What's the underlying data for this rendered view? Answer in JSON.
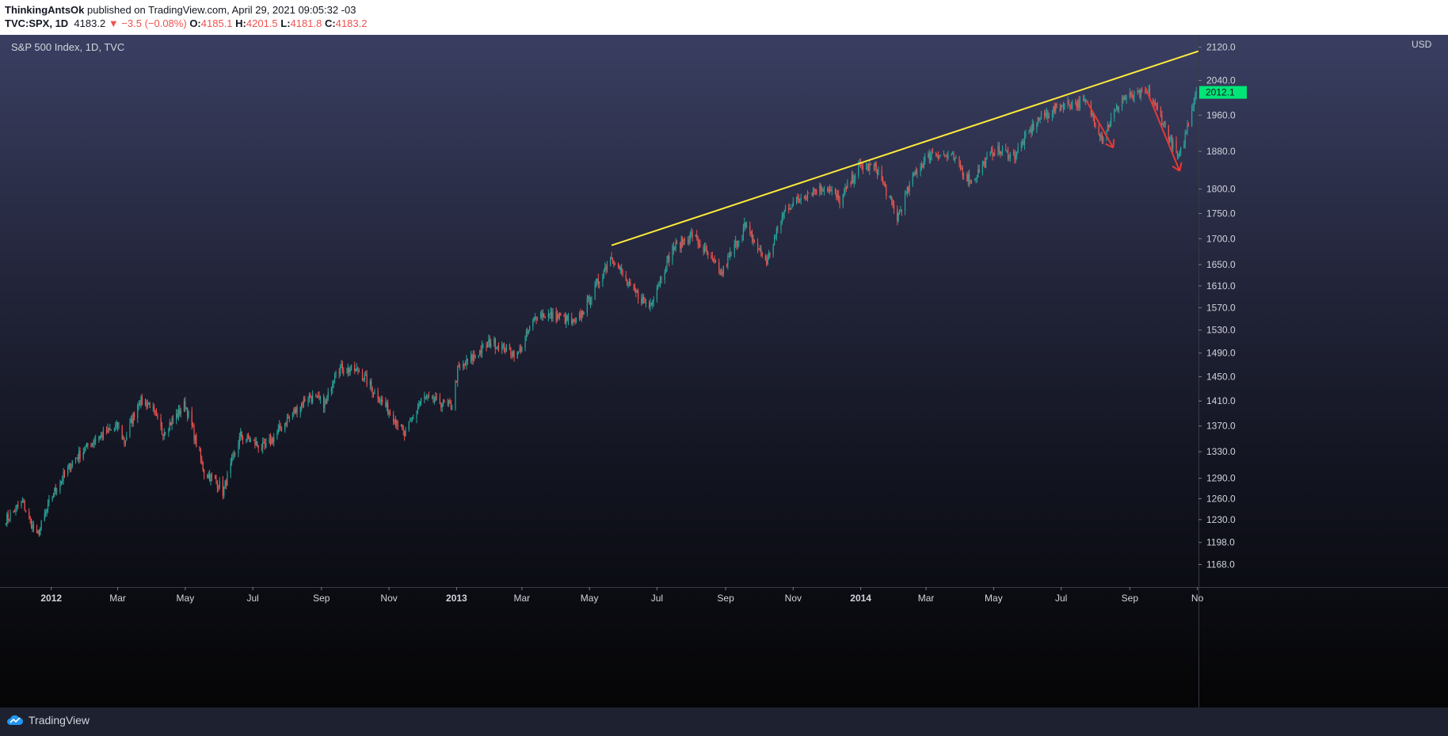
{
  "header": {
    "author": "ThinkingAntsOk",
    "published_text": "published on TradingView.com, April 29, 2021 09:05:32 -03",
    "symbol": "TVC:SPX, 1D",
    "last_price": "4183.2",
    "change": "▼ −3.5 (−0.08%)",
    "open_label": "O:",
    "open": "4185.1",
    "high_label": "H:",
    "high": "4201.5",
    "low_label": "L:",
    "low": "4181.8",
    "close_label": "C:",
    "close": "4183.2"
  },
  "chart_title": "S&P 500 Index, 1D, TVC",
  "footer": {
    "brand": "TradingView"
  },
  "colors": {
    "up": "#26a69a",
    "down": "#ef5350",
    "trendline": "#ffeb3b",
    "arrow": "#e53935",
    "last_price_bg": "#00e676"
  },
  "chart_data": {
    "type": "candlestick",
    "title": "S&P 500 Index, 1D, TVC",
    "currency": "USD",
    "y_scale": "log",
    "ylim": [
      1138,
      2150
    ],
    "y_ticks": [
      "2120.0",
      "2040.0",
      "1960.0",
      "1880.0",
      "1800.0",
      "1750.0",
      "1700.0",
      "1650.0",
      "1610.0",
      "1570.0",
      "1530.0",
      "1490.0",
      "1450.0",
      "1410.0",
      "1370.0",
      "1330.0",
      "1290.0",
      "1260.0",
      "1230.0",
      "1198.0",
      "1168.0"
    ],
    "y_tick_values": [
      2120,
      2040,
      1960,
      1880,
      1800,
      1750,
      1700,
      1650,
      1610,
      1570,
      1530,
      1490,
      1450,
      1410,
      1370,
      1330,
      1290,
      1260,
      1230,
      1198,
      1168
    ],
    "x_ticks": [
      {
        "label": "2012",
        "date": "2012-01-01",
        "bold": true
      },
      {
        "label": "Mar",
        "date": "2012-03-01",
        "bold": false
      },
      {
        "label": "May",
        "date": "2012-05-01",
        "bold": false
      },
      {
        "label": "Jul",
        "date": "2012-07-01",
        "bold": false
      },
      {
        "label": "Sep",
        "date": "2012-09-01",
        "bold": false
      },
      {
        "label": "Nov",
        "date": "2012-11-01",
        "bold": false
      },
      {
        "label": "2013",
        "date": "2013-01-01",
        "bold": true
      },
      {
        "label": "Mar",
        "date": "2013-03-01",
        "bold": false
      },
      {
        "label": "May",
        "date": "2013-05-01",
        "bold": false
      },
      {
        "label": "Jul",
        "date": "2013-07-01",
        "bold": false
      },
      {
        "label": "Sep",
        "date": "2013-09-01",
        "bold": false
      },
      {
        "label": "Nov",
        "date": "2013-11-01",
        "bold": false
      },
      {
        "label": "2014",
        "date": "2014-01-01",
        "bold": true
      },
      {
        "label": "Mar",
        "date": "2014-03-01",
        "bold": false
      },
      {
        "label": "May",
        "date": "2014-05-01",
        "bold": false
      },
      {
        "label": "Jul",
        "date": "2014-07-01",
        "bold": false
      },
      {
        "label": "Sep",
        "date": "2014-09-01",
        "bold": false
      },
      {
        "label": "No",
        "date": "2014-11-01",
        "bold": false
      }
    ],
    "xlim": [
      "2011-11-20",
      "2014-11-02"
    ],
    "last_price": 2012.1,
    "last_price_label": "2012.1",
    "series": [
      {
        "date": "2011-11-21",
        "close": 1230
      },
      {
        "date": "2011-12-06",
        "close": 1255
      },
      {
        "date": "2011-12-19",
        "close": 1205
      },
      {
        "date": "2012-01-02",
        "close": 1265
      },
      {
        "date": "2012-01-20",
        "close": 1315
      },
      {
        "date": "2012-02-10",
        "close": 1350
      },
      {
        "date": "2012-03-01",
        "close": 1370
      },
      {
        "date": "2012-03-07",
        "close": 1345
      },
      {
        "date": "2012-03-20",
        "close": 1410
      },
      {
        "date": "2012-03-30",
        "close": 1405
      },
      {
        "date": "2012-04-10",
        "close": 1360
      },
      {
        "date": "2012-04-20",
        "close": 1380
      },
      {
        "date": "2012-05-01",
        "close": 1405
      },
      {
        "date": "2012-05-18",
        "close": 1300
      },
      {
        "date": "2012-06-01",
        "close": 1280
      },
      {
        "date": "2012-06-04",
        "close": 1270
      },
      {
        "date": "2012-06-20",
        "close": 1355
      },
      {
        "date": "2012-07-12",
        "close": 1335
      },
      {
        "date": "2012-08-01",
        "close": 1380
      },
      {
        "date": "2012-08-20",
        "close": 1418
      },
      {
        "date": "2012-09-05",
        "close": 1405
      },
      {
        "date": "2012-09-14",
        "close": 1465
      },
      {
        "date": "2012-10-05",
        "close": 1460
      },
      {
        "date": "2012-10-25",
        "close": 1410
      },
      {
        "date": "2012-11-08",
        "close": 1378
      },
      {
        "date": "2012-11-15",
        "close": 1355
      },
      {
        "date": "2012-12-01",
        "close": 1415
      },
      {
        "date": "2012-12-28",
        "close": 1402
      },
      {
        "date": "2013-01-02",
        "close": 1460
      },
      {
        "date": "2013-02-01",
        "close": 1510
      },
      {
        "date": "2013-02-25",
        "close": 1487
      },
      {
        "date": "2013-03-15",
        "close": 1560
      },
      {
        "date": "2013-04-05",
        "close": 1553
      },
      {
        "date": "2013-04-18",
        "close": 1540
      },
      {
        "date": "2013-05-01",
        "close": 1585
      },
      {
        "date": "2013-05-21",
        "close": 1669
      },
      {
        "date": "2013-06-05",
        "close": 1610
      },
      {
        "date": "2013-06-24",
        "close": 1573
      },
      {
        "date": "2013-07-15",
        "close": 1680
      },
      {
        "date": "2013-08-02",
        "close": 1709
      },
      {
        "date": "2013-08-28",
        "close": 1631
      },
      {
        "date": "2013-09-18",
        "close": 1725
      },
      {
        "date": "2013-10-08",
        "close": 1655
      },
      {
        "date": "2013-10-25",
        "close": 1760
      },
      {
        "date": "2013-11-15",
        "close": 1795
      },
      {
        "date": "2013-12-01",
        "close": 1805
      },
      {
        "date": "2013-12-13",
        "close": 1775
      },
      {
        "date": "2013-12-31",
        "close": 1848
      },
      {
        "date": "2014-01-15",
        "close": 1845
      },
      {
        "date": "2014-02-03",
        "close": 1741
      },
      {
        "date": "2014-02-20",
        "close": 1840
      },
      {
        "date": "2014-03-07",
        "close": 1878
      },
      {
        "date": "2014-03-25",
        "close": 1865
      },
      {
        "date": "2014-04-11",
        "close": 1815
      },
      {
        "date": "2014-05-01",
        "close": 1883
      },
      {
        "date": "2014-05-20",
        "close": 1872
      },
      {
        "date": "2014-06-10",
        "close": 1950
      },
      {
        "date": "2014-07-03",
        "close": 1985
      },
      {
        "date": "2014-07-24",
        "close": 1988
      },
      {
        "date": "2014-08-07",
        "close": 1910
      },
      {
        "date": "2014-08-25",
        "close": 1998
      },
      {
        "date": "2014-09-18",
        "close": 2011
      },
      {
        "date": "2014-10-01",
        "close": 1946
      },
      {
        "date": "2014-10-15",
        "close": 1862
      },
      {
        "date": "2014-10-20",
        "close": 1904
      },
      {
        "date": "2014-10-31",
        "close": 2018
      }
    ],
    "trendline": [
      {
        "date": "2013-05-21",
        "value": 1687
      },
      {
        "date": "2014-11-02",
        "value": 2110
      }
    ],
    "arrows": [
      {
        "from": {
          "date": "2014-07-24",
          "value": 1992
        },
        "to": {
          "date": "2014-08-17",
          "value": 1888
        }
      },
      {
        "from": {
          "date": "2014-09-15",
          "value": 2024
        },
        "to": {
          "date": "2014-10-16",
          "value": 1838
        }
      }
    ]
  }
}
